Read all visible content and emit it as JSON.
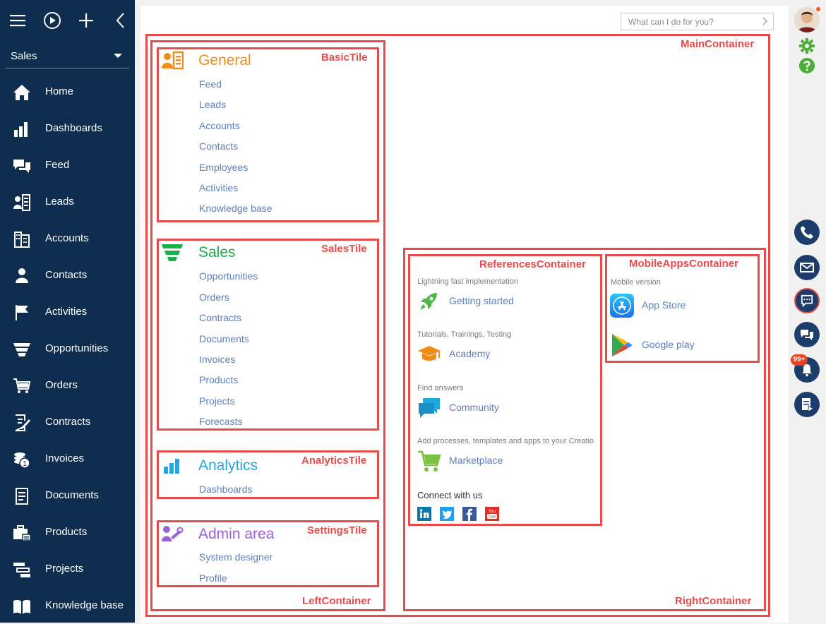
{
  "sidebar": {
    "workspace": "Sales",
    "items": [
      {
        "label": "Home",
        "icon": "home-icon"
      },
      {
        "label": "Dashboards",
        "icon": "dashboards-icon"
      },
      {
        "label": "Feed",
        "icon": "feed-icon"
      },
      {
        "label": "Leads",
        "icon": "leads-icon"
      },
      {
        "label": "Accounts",
        "icon": "accounts-icon"
      },
      {
        "label": "Contacts",
        "icon": "contacts-icon"
      },
      {
        "label": "Activities",
        "icon": "activities-icon"
      },
      {
        "label": "Opportunities",
        "icon": "opportunities-icon"
      },
      {
        "label": "Orders",
        "icon": "orders-icon"
      },
      {
        "label": "Contracts",
        "icon": "contracts-icon"
      },
      {
        "label": "Invoices",
        "icon": "invoices-icon"
      },
      {
        "label": "Documents",
        "icon": "documents-icon"
      },
      {
        "label": "Products",
        "icon": "products-icon"
      },
      {
        "label": "Projects",
        "icon": "projects-icon"
      },
      {
        "label": "Knowledge base",
        "icon": "knowledge-base-icon"
      }
    ]
  },
  "search": {
    "placeholder": "What can I do for you?"
  },
  "labels": {
    "main": "MainContainer",
    "left": "LeftContainer",
    "right": "RightContainer",
    "basic": "BasicTile",
    "sales": "SalesTile",
    "analytics": "AnalyticsTile",
    "settings": "SettingsTile",
    "references": "ReferencesContainer",
    "mobile": "MobileAppsContainer"
  },
  "tiles": {
    "general": {
      "title": "General",
      "color": "#f28c18",
      "links": [
        "Feed",
        "Leads",
        "Accounts",
        "Contacts",
        "Employees",
        "Activities",
        "Knowledge base"
      ]
    },
    "sales": {
      "title": "Sales",
      "color": "#18b248",
      "links": [
        "Opportunities",
        "Orders",
        "Contracts",
        "Documents",
        "Invoices",
        "Products",
        "Projects",
        "Forecasts"
      ]
    },
    "analytics": {
      "title": "Analytics",
      "color": "#22a8e0",
      "links": [
        "Dashboards"
      ]
    },
    "admin": {
      "title": "Admin area",
      "color": "#9a62d8",
      "links": [
        "System designer",
        "Profile"
      ]
    }
  },
  "references": {
    "items": [
      {
        "caption": "Lightning fast implementation",
        "link": "Getting started",
        "icon": "rocket-icon"
      },
      {
        "caption": "Tutorials, Trainings, Testing",
        "link": "Academy",
        "icon": "graduation-cap-icon"
      },
      {
        "caption": "Find answers",
        "link": "Community",
        "icon": "chat-bubbles-icon"
      },
      {
        "caption": "Add processes, templates and apps to your Creatio",
        "link": "Marketplace",
        "icon": "cart-icon"
      }
    ],
    "connect": "Connect with us",
    "social": [
      "linkedin-icon",
      "twitter-icon",
      "facebook-icon",
      "youtube-icon"
    ]
  },
  "mobile": {
    "caption": "Mobile version",
    "items": [
      {
        "label": "App Store",
        "icon": "app-store-icon"
      },
      {
        "label": "Google play",
        "icon": "google-play-icon"
      }
    ]
  },
  "rail": {
    "notification_badge": "99+"
  },
  "colors": {
    "sidebar": "#0e2d4f",
    "accent_red": "#e84b4b",
    "link": "#5b7fbf"
  }
}
